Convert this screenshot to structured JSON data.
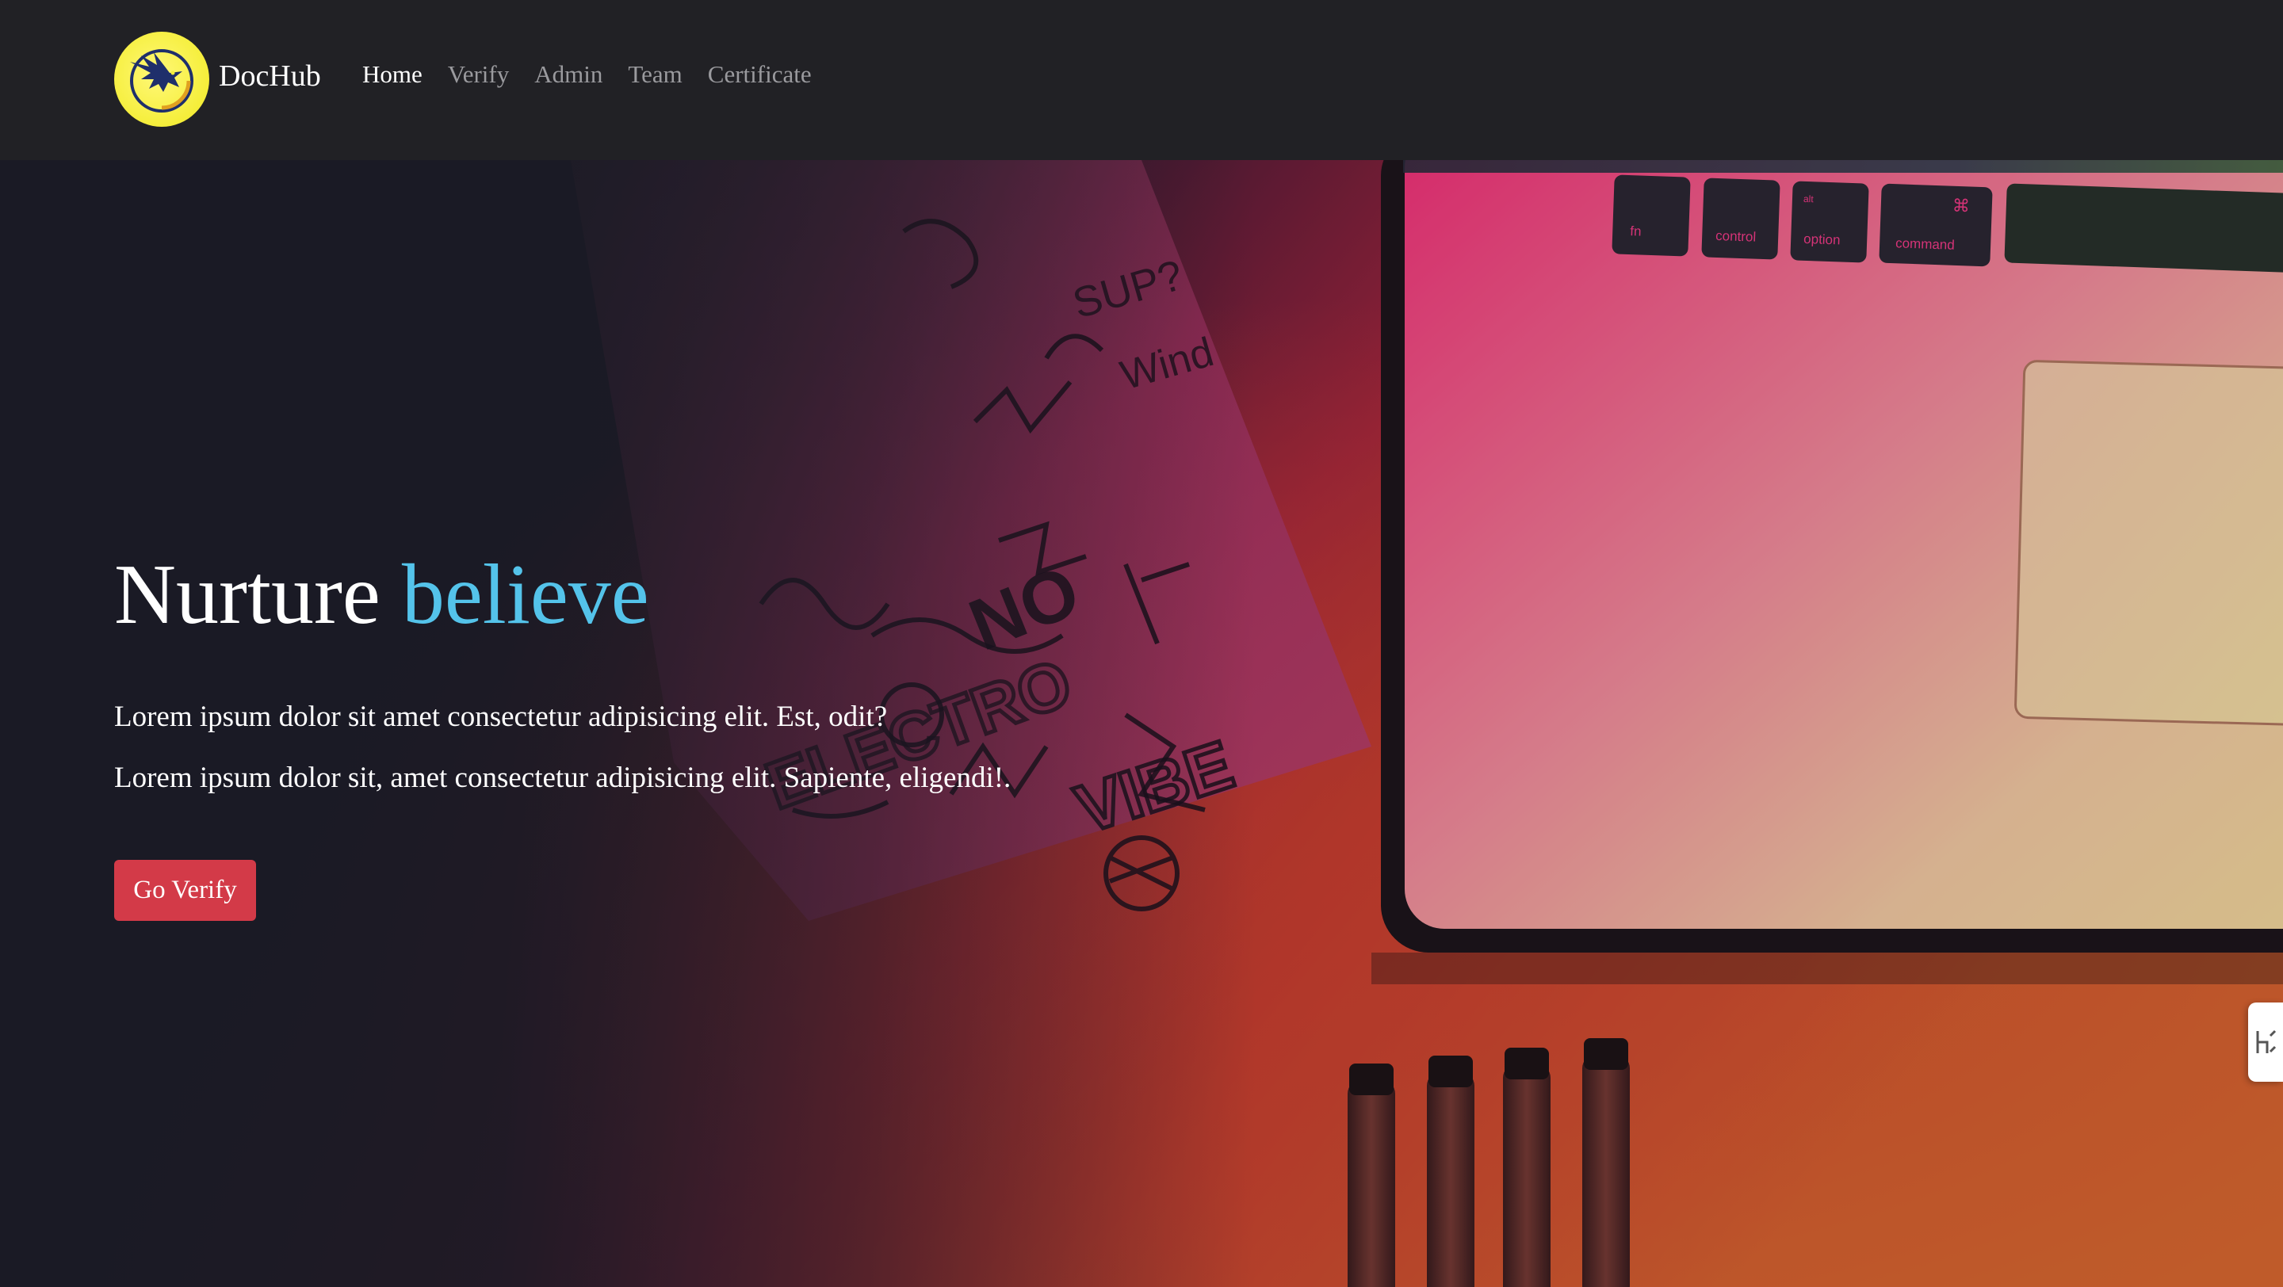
{
  "brand": {
    "name": "DocHub",
    "logo_icon": "eagle-logo-icon",
    "logo_color": "#f5ee3a"
  },
  "nav": {
    "items": [
      {
        "label": "Home",
        "active": true
      },
      {
        "label": "Verify",
        "active": false
      },
      {
        "label": "Admin",
        "active": false
      },
      {
        "label": "Team",
        "active": false
      },
      {
        "label": "Certificate",
        "active": false
      }
    ]
  },
  "hero": {
    "title_main": "Nurture",
    "title_accent": "believe",
    "paragraph_1": "Lorem ipsum dolor sit amet consectetur adipisicing elit. Est, odit?",
    "paragraph_2": "Lorem ipsum dolor sit, amet consectetur adipisicing elit. Sapiente, eligendi!.",
    "cta_label": "Go Verify",
    "background_image": "desk-laptop-doodle-photo",
    "keyboard_keys": [
      "fn",
      "control",
      "option",
      "command",
      "alt",
      "⌘"
    ]
  },
  "side_tab": {
    "icon": "hypothesis-icon"
  },
  "colors": {
    "navbar_bg": "#212125",
    "accent": "#54c3ea",
    "cta_bg": "#d33a48",
    "nav_active": "#ffffff",
    "nav_inactive": "#9a9a9e"
  }
}
